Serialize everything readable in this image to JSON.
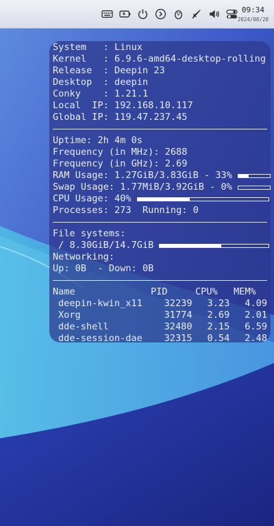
{
  "taskbar": {
    "icons": [
      "keyboard-icon",
      "battery-icon",
      "power-icon",
      "media-next-icon",
      "penguin-icon",
      "rocket-icon",
      "volume-icon",
      "settings-toggle-icon"
    ],
    "time": "09:34",
    "date": "2024/08/20"
  },
  "conky": {
    "system": [
      {
        "label": "System   ",
        "sep": ": ",
        "value": "Linux"
      },
      {
        "label": "Kernel   ",
        "sep": ": ",
        "value": "6.9.6-amd64-desktop-rolling"
      },
      {
        "label": "Release  ",
        "sep": ": ",
        "value": "Deepin 23"
      },
      {
        "label": "Desktop  ",
        "sep": ": ",
        "value": "deepin"
      },
      {
        "label": "Conky    ",
        "sep": ": ",
        "value": "1.21.1"
      },
      {
        "label": "Local  IP",
        "sep": ": ",
        "value": "192.168.10.117"
      },
      {
        "label": "Global IP",
        "sep": ": ",
        "value": "119.47.237.45"
      }
    ],
    "uptime_label": "Uptime: ",
    "uptime": "2h 4m 0s",
    "freq_mhz_label": "Frequency (in MHz): ",
    "freq_mhz": "2688",
    "freq_ghz_label": "Frequency (in GHz): ",
    "freq_ghz": "2.69",
    "ram_label": "RAM Usage: ",
    "ram": "1.27GiB/3.83GiB - 33%",
    "ram_fraction": 0.33,
    "swap_label": "Swap Usage: ",
    "swap": "1.77MiB/3.92GiB - 0%",
    "swap_fraction": 0.0,
    "cpu_label": "CPU Usage: ",
    "cpu": "40%",
    "cpu_fraction": 0.4,
    "processes_label": "Processes: ",
    "processes": "273",
    "running_label": "Running: ",
    "running": "0",
    "fs_label": "File systems:",
    "fs_root": " / 8.30GiB/14.7GiB",
    "fs_fraction": 0.565,
    "net_label": "Networking:",
    "up_label": "Up: ",
    "up": "0B",
    "down_label": "  - Down: ",
    "down": "0B",
    "proc_headers": {
      "name": "Name",
      "pid": "PID",
      "cpu": "CPU%",
      "mem": "MEM%"
    },
    "procs": [
      {
        "name": "deepin-kwin_x11",
        "pid": "32239",
        "cpu": "3.23",
        "mem": "4.09"
      },
      {
        "name": "Xorg",
        "pid": "31774",
        "cpu": "2.69",
        "mem": "2.01"
      },
      {
        "name": "dde-shell",
        "pid": "32480",
        "cpu": "2.15",
        "mem": "6.59"
      },
      {
        "name": "dde-session-dae",
        "pid": "32315",
        "cpu": "0.54",
        "mem": "2.48"
      }
    ]
  },
  "colors": {
    "panel": "#2d378c",
    "accent": "#ffffff",
    "wallpaper": "#2f3fa8"
  }
}
